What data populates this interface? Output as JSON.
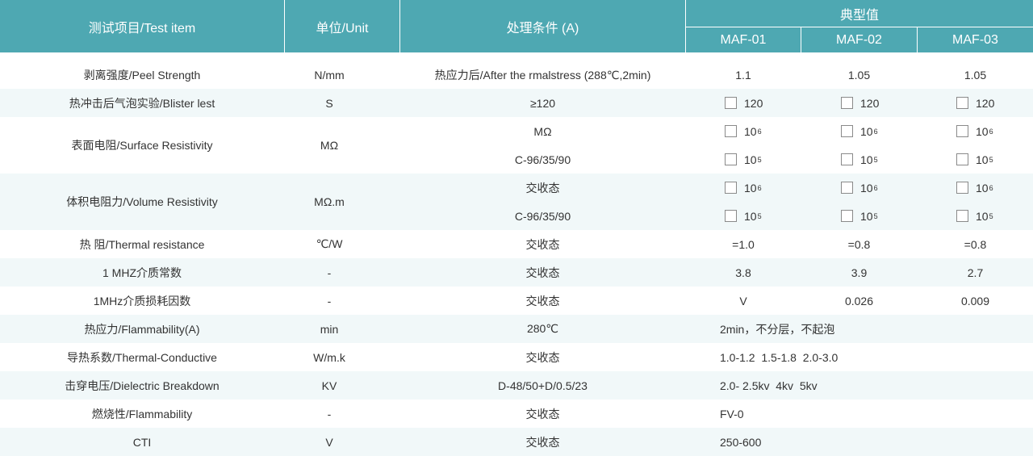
{
  "header": {
    "col_item": "测试项目/Test item",
    "col_unit": "单位/Unit",
    "col_cond": "处理条件 (A)",
    "col_typical": "典型值",
    "products": [
      "MAF-01",
      "MAF-02",
      "MAF-03"
    ]
  },
  "rows": {
    "peel": {
      "item": "剥离强度/Peel Strength",
      "unit": "N/mm",
      "cond": "热应力后/After the rmalstress (288℃,2min)",
      "v1": "1.1",
      "v2": "1.05",
      "v3": "1.05"
    },
    "blister": {
      "item": "热冲击后气泡实验/Blister lest",
      "unit": "S",
      "cond": "≥120",
      "v1": "120",
      "v2": "120",
      "v3": "120"
    },
    "surface": {
      "item": "表面电阻/Surface Resistivity",
      "unit": "MΩ",
      "cond_a": "MΩ",
      "cond_b": "C-96/35/90",
      "base": "10",
      "exp_a": "6",
      "exp_b": "5"
    },
    "volume": {
      "item": "体积电阻力/Volume Resistivity",
      "unit": "MΩ.m",
      "cond_a": "交收态",
      "cond_b": "C-96/35/90",
      "base": "10",
      "exp_a": "6",
      "exp_b": "5"
    },
    "thermal_res": {
      "item": "热 阻/Thermal resistance",
      "unit": "℃/W",
      "cond": "交收态",
      "v1": "=1.0",
      "v2": "=0.8",
      "v3": "=0.8"
    },
    "dk": {
      "item": "1 MHZ介质常数",
      "unit": "-",
      "cond": "交收态",
      "v1": "3.8",
      "v2": "3.9",
      "v3": "2.7"
    },
    "df": {
      "item": "1MHz介质损耗因数",
      "unit": "-",
      "cond": "交收态",
      "v1": "V",
      "v2": "0.026",
      "v3": "0.009"
    },
    "flam_a": {
      "item": "热应力/Flammability(A)",
      "unit": "min",
      "cond": "280℃",
      "value": "2min，不分层，不起泡"
    },
    "conductive": {
      "item": "导热系数/Thermal-Conductive",
      "unit": "W/m.k",
      "cond": "交收态",
      "value": "1.0-1.2  1.5-1.8  2.0-3.0"
    },
    "breakdown": {
      "item": "击穿电压/Dielectric Breakdown",
      "unit": "KV",
      "cond": "D-48/50+D/0.5/23",
      "value": "2.0- 2.5kv  4kv  5kv"
    },
    "flammability": {
      "item": "燃烧性/Flammability",
      "unit": "-",
      "cond": "交收态",
      "value": "FV-0"
    },
    "cti": {
      "item": "CTI",
      "unit": "V",
      "cond": "交收态",
      "value": "250-600"
    }
  }
}
